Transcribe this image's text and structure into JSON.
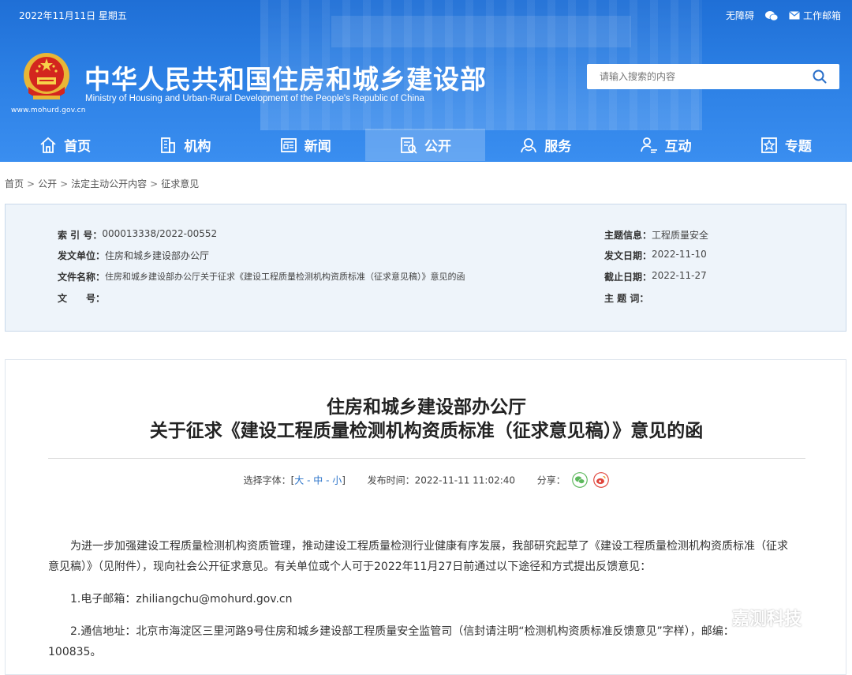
{
  "topbar": {
    "date": "2022年11月11日 星期五",
    "accessibility": "无障碍",
    "work_mail": "工作邮箱"
  },
  "header": {
    "site_title": "中华人民共和国住房和城乡建设部",
    "site_subtitle": "Ministry of Housing and Urban-Rural Development of the People's Republic of China",
    "site_url": "www.mohurd.gov.cn",
    "search_placeholder": "请输入搜索的内容"
  },
  "nav": [
    {
      "label": "首页",
      "icon": "home-icon"
    },
    {
      "label": "机构",
      "icon": "building-icon"
    },
    {
      "label": "新闻",
      "icon": "news-icon"
    },
    {
      "label": "公开",
      "icon": "disclosure-icon",
      "active": true
    },
    {
      "label": "服务",
      "icon": "service-icon"
    },
    {
      "label": "互动",
      "icon": "interact-icon"
    },
    {
      "label": "专题",
      "icon": "topic-icon"
    }
  ],
  "breadcrumb": [
    "首页",
    "公开",
    "法定主动公开内容",
    "征求意见"
  ],
  "meta": {
    "index_label": "索 引 号：",
    "index_value": "000013338/2022-00552",
    "issuer_label": "发文单位：",
    "issuer_value": "住房和城乡建设部办公厅",
    "docname_label": "文件名称：",
    "docname_value": "住房和城乡建设部办公厅关于征求《建设工程质量检测机构资质标准（征求意见稿）》意见的函",
    "docno_label": "文　　号：",
    "docno_value": "",
    "topic_label": "主题信息：",
    "topic_value": "工程质量安全",
    "issue_date_label": "发文日期：",
    "issue_date_value": "2022-11-10",
    "deadline_label": "截止日期：",
    "deadline_value": "2022-11-27",
    "keywords_label": "主 题 词：",
    "keywords_value": ""
  },
  "article": {
    "title_line1": "住房和城乡建设部办公厅",
    "title_line2": "关于征求《建设工程质量检测机构资质标准（征求意见稿）》意见的函",
    "font_select_label": "选择字体：[",
    "font_large": "大",
    "font_medium": "中",
    "font_small": "小",
    "font_select_end": "]",
    "publish_time": "发布时间：2022-11-11 11:02:40",
    "share_label": "分享：",
    "para1_line1": "　　为进一步加强建设工程质量检测机构资质管理，推动建设工程质量检测行业健康有序发展，我部研究起草了《建设工程质量检测机构资质标准（征求",
    "para1_line2": "意见稿）》（见附件），现向社会公开征求意见。有关单位或个人可于2022年11月27日前通过以下途径和方式提出反馈意见：",
    "para2": "　　1.电子邮箱：zhiliangchu@mohurd.gov.cn",
    "para3_line1": "　　2.通信地址：北京市海淀区三里河路9号住房和城乡建设部工程质量安全监管司（信封请注明“检测机构资质标准反馈意见”字样），邮编：",
    "para3_line2": "100835。"
  },
  "watermark": "嘉测科技"
}
